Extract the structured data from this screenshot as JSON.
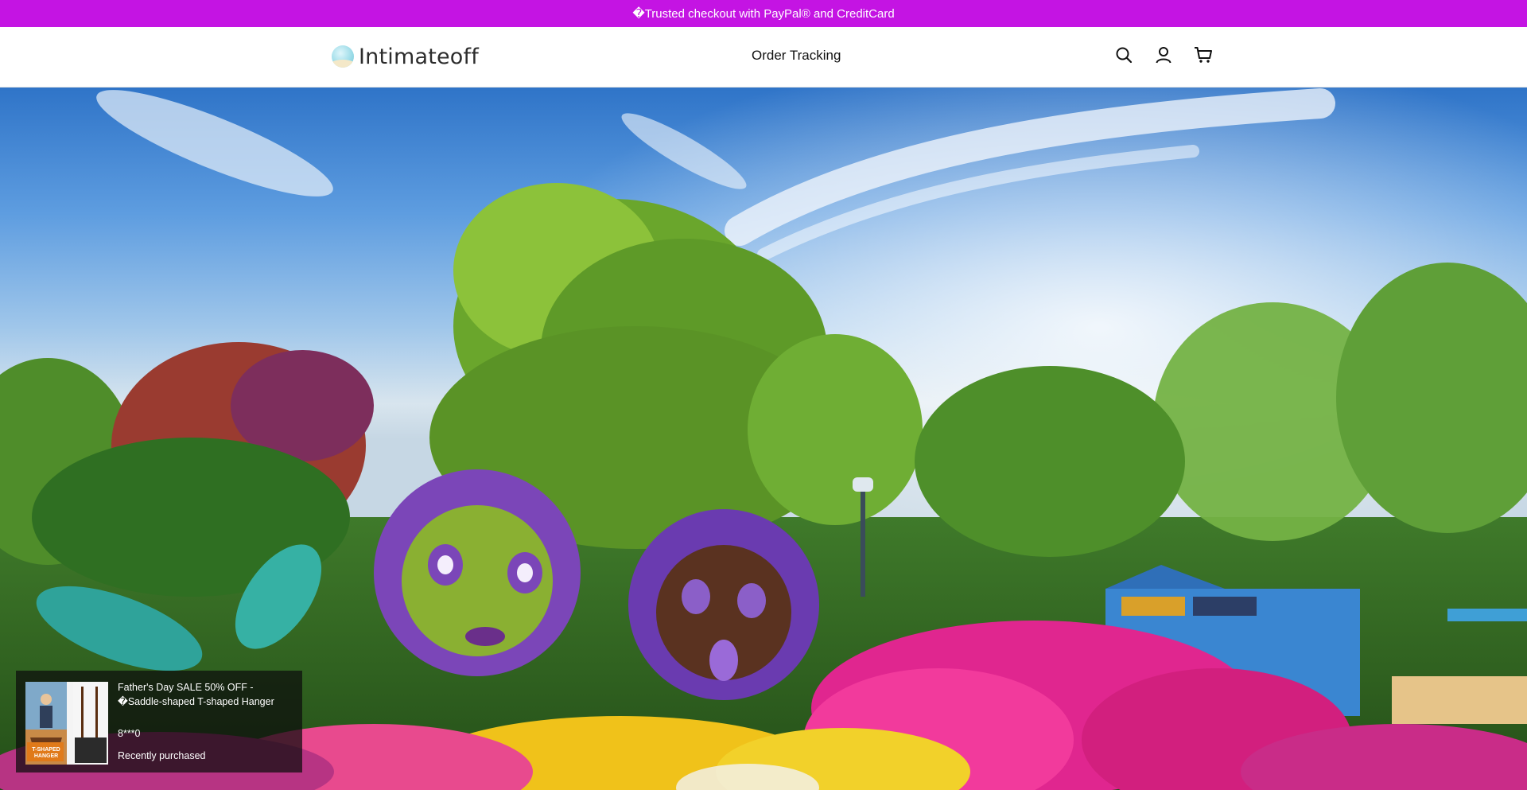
{
  "announcement": {
    "text": "�Trusted checkout with PayPal® and CreditCard",
    "background_color": "#c414e3"
  },
  "header": {
    "logo_text": "Intimateoff",
    "nav": [
      {
        "label": "Order Tracking"
      }
    ],
    "icons": [
      "search-icon",
      "account-icon",
      "cart-icon"
    ]
  },
  "hero": {
    "image_description": "Garden with tall green trees, blue sky with clouds, and colorful flower sculptures of cartoon characters"
  },
  "recent_purchase_popup": {
    "title": "Father's Day SALE 50% OFF - �Saddle-shaped T-shaped Hanger",
    "buyer": "8***0",
    "status": "Recently purchased",
    "thumbnail_label": "T-SHAPED HANGER"
  }
}
